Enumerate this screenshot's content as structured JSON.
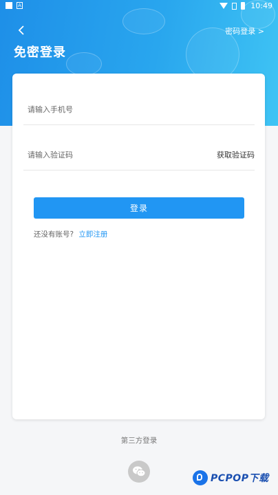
{
  "status_bar": {
    "time": "10:49",
    "notif_icon_letter": "A"
  },
  "header": {
    "title": "免密登录",
    "password_login_link": "密码登录 >"
  },
  "form": {
    "phone_placeholder": "请输入手机号",
    "phone_value": "",
    "code_placeholder": "请输入验证码",
    "code_value": "",
    "get_code_label": "获取验证码",
    "login_button": "登录",
    "no_account_text": "还没有账号?",
    "register_link": "立即注册"
  },
  "third_party": {
    "title": "第三方登录",
    "icons": [
      "wechat-icon"
    ]
  },
  "colors": {
    "primary": "#2196f3",
    "header_start": "#1e8fe8",
    "header_end": "#3fc4f4"
  },
  "watermark": {
    "text": "PCPOP下载"
  }
}
